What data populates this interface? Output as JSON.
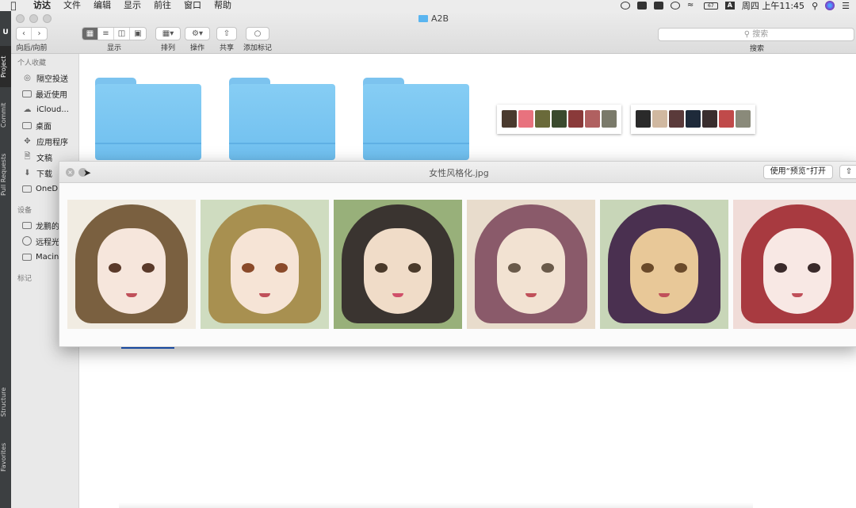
{
  "menubar": {
    "items": [
      "访达",
      "文件",
      "编辑",
      "显示",
      "前往",
      "窗口",
      "帮助"
    ],
    "battery": "67",
    "input_method": "A",
    "clock": "周四 上午11:45"
  },
  "ide": {
    "tabs": [
      "Project",
      "Commit",
      "Pull Requests",
      "Structure",
      "Favorites"
    ]
  },
  "finder": {
    "window_title": "A2B",
    "toolbar": {
      "back_forward_label": "向后/向前",
      "view_label": "显示",
      "arrange_label": "排列",
      "action_label": "操作",
      "share_label": "共享",
      "tags_label": "添加标记",
      "search_placeholder": "搜索",
      "search_label": "搜索"
    },
    "sidebar": {
      "favorites_header": "个人收藏",
      "favorites": [
        "隔空投送",
        "最近使用",
        "iCloud...",
        "桌面",
        "应用程序",
        "文稿",
        "下载",
        "OneD"
      ],
      "devices_header": "设备",
      "devices": [
        "龙鹏的",
        "远程光",
        "Macin"
      ],
      "tags_header": "标记"
    }
  },
  "quicklook": {
    "filename": "女性风格化.jpg",
    "open_button": "使用“预览”打开"
  },
  "colors": {
    "folder_blue": "#6fbfef",
    "selection_blue": "#2060d0",
    "menubar_bg": "#ececec"
  }
}
